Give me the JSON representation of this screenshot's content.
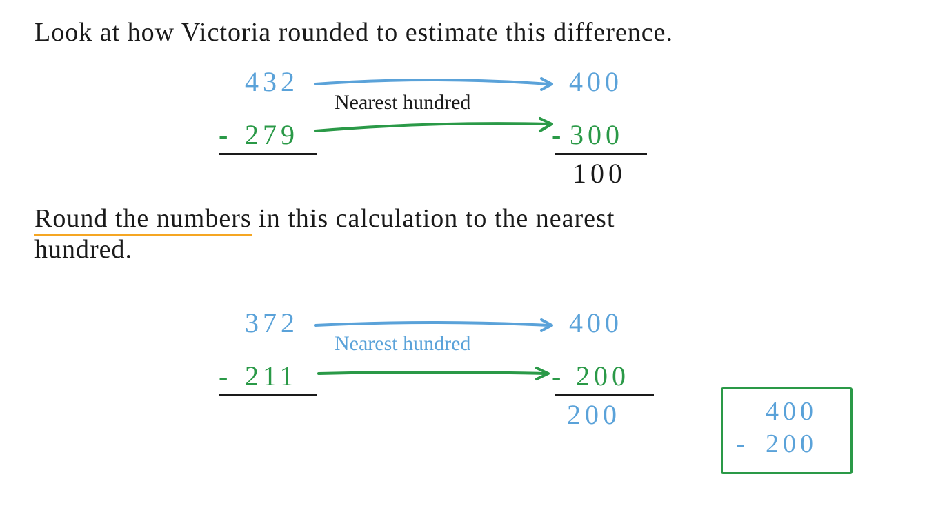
{
  "line1": "Look at how Victoria rounded to estimate this difference.",
  "example1": {
    "top": "432",
    "bottom": "279",
    "label": "Nearest hundred",
    "topRounded": "400",
    "bottomRounded": "300",
    "result": "100"
  },
  "line2a": "Round the numbers",
  "line2b": " in this calculation to the nearest",
  "line2c": "hundred.",
  "example2": {
    "top": "372",
    "bottom": "211",
    "label": "Nearest hundred",
    "topRounded": "400",
    "bottomRounded": "200",
    "result": "200"
  },
  "answer": {
    "top": "400",
    "bottom": "200"
  },
  "minus": "-"
}
